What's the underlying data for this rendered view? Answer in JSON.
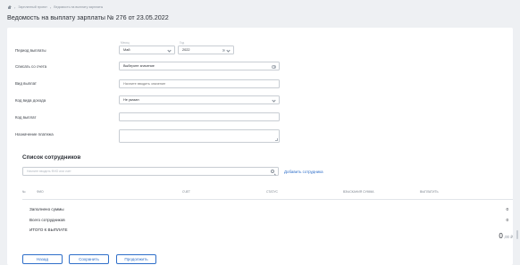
{
  "breadcrumb": {
    "items": [
      "Зарплатный проект",
      "Ведомость на выплату зарплаты"
    ]
  },
  "page": {
    "title": "Ведомость на выплату зарплаты № 276 от 23.05.2022"
  },
  "form": {
    "period": {
      "label": "Период выплаты",
      "month_caption": "Месяц",
      "month_value": "Май",
      "year_caption": "Год",
      "year_value": "2022"
    },
    "debit_account": {
      "label": "Списать со счета",
      "placeholder": "Выберите значение"
    },
    "payment_type": {
      "label": "Вид выплат",
      "placeholder": "Начните вводить значение"
    },
    "income_code": {
      "label": "Код вида дохода",
      "value": "Не указан"
    },
    "payment_code": {
      "label": "Код выплат",
      "value": ""
    },
    "purpose": {
      "label": "Назначение платежа",
      "value": ""
    }
  },
  "employees": {
    "title": "Список сотрудников",
    "search_placeholder": "Начните вводить ФИО или счет",
    "add_link": "Добавить сотрудника",
    "columns": [
      "№",
      "ФИО",
      "Счет",
      "Статус",
      "Взыскания сумма",
      "Выплатить"
    ]
  },
  "summary": {
    "filled_label": "Заполнено суммы",
    "filled_value": "0",
    "total_employees_label": "Всего сотрудников",
    "total_employees_value": "0",
    "total_label": "Итого к выплате",
    "total_int": "0",
    "total_frac": ",00 ₽"
  },
  "actions": {
    "back": "Назад",
    "save": "Сохранить",
    "continue": "Продолжить"
  },
  "colors": {
    "accent": "#2f6fc9",
    "background": "#eef0f3",
    "card": "#ffffff"
  }
}
